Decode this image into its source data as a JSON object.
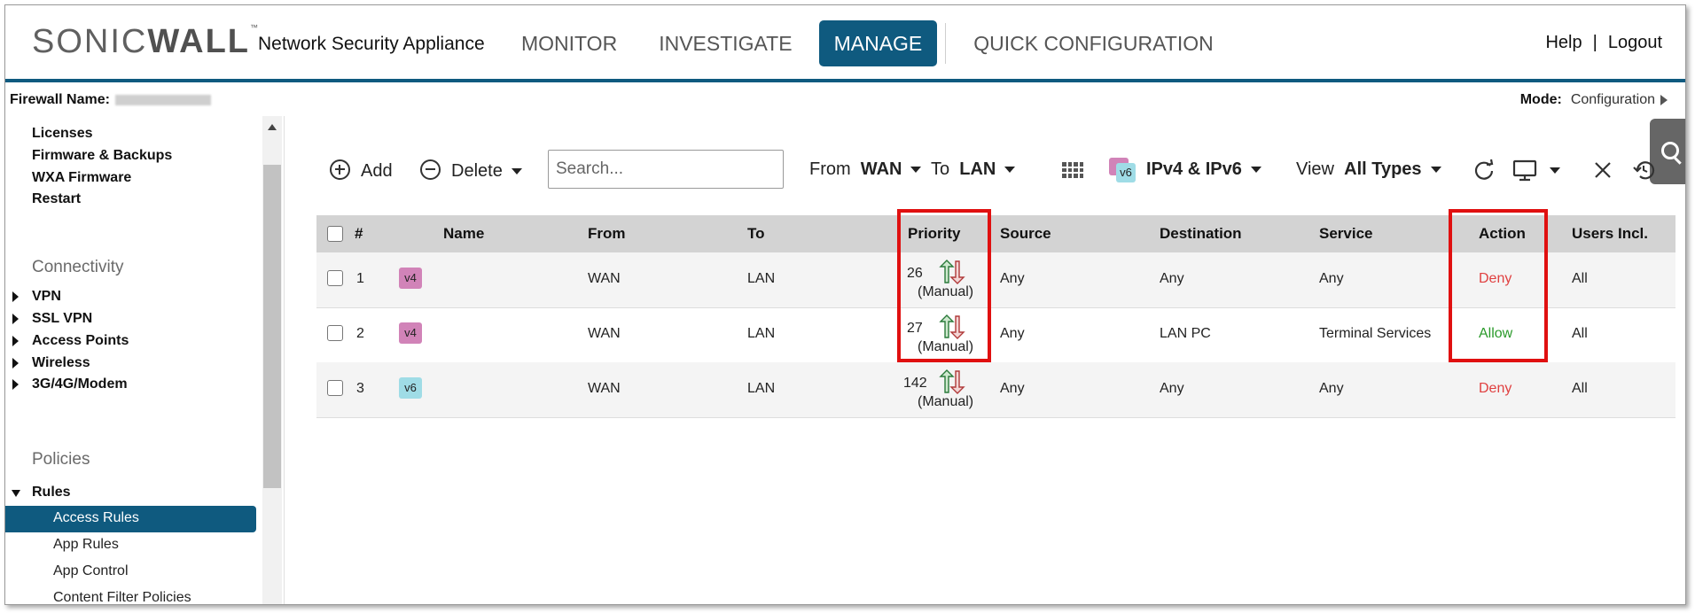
{
  "header": {
    "logo_sonic": "SONIC",
    "logo_wall": "WALL",
    "logo_tm": "™",
    "app_name": "Network Security Appliance",
    "nav": [
      "MONITOR",
      "INVESTIGATE",
      "MANAGE",
      "QUICK CONFIGURATION"
    ],
    "nav_active": "MANAGE",
    "help": "Help",
    "separator": "|",
    "logout": "Logout"
  },
  "info": {
    "firewall_label": "Firewall Name:",
    "mode_label": "Mode:",
    "mode_value": "Configuration"
  },
  "sidebar": {
    "top_items": [
      "Licenses",
      "Firmware & Backups",
      "WXA Firmware",
      "Restart"
    ],
    "connectivity_label": "Connectivity",
    "connectivity_items": [
      "VPN",
      "SSL VPN",
      "Access Points",
      "Wireless",
      "3G/4G/Modem"
    ],
    "policies_label": "Policies",
    "rules_label": "Rules",
    "rules_items": [
      "Access Rules",
      "App Rules",
      "App Control",
      "Content Filter Policies"
    ],
    "active_item": "Access Rules"
  },
  "toolbar": {
    "add": "Add",
    "delete": "Delete",
    "search_placeholder": "Search...",
    "from_label": "From",
    "from_value": "WAN",
    "to_label": "To",
    "to_value": "LAN",
    "ip_badge": "v6",
    "ip_value": "IPv4 & IPv6",
    "view_label": "View",
    "view_value": "All Types"
  },
  "table": {
    "columns": [
      "#",
      "Name",
      "From",
      "To",
      "Priority",
      "Source",
      "Destination",
      "Service",
      "Action",
      "Users Incl."
    ],
    "rows": [
      {
        "num": "1",
        "ip": "v4",
        "name": "",
        "from": "WAN",
        "to": "LAN",
        "priority": "26",
        "priority_mode": "(Manual)",
        "source": "Any",
        "destination": "Any",
        "service": "Any",
        "action": "Deny",
        "users": "All"
      },
      {
        "num": "2",
        "ip": "v4",
        "name": "",
        "from": "WAN",
        "to": "LAN",
        "priority": "27",
        "priority_mode": "(Manual)",
        "source": "Any",
        "destination": "LAN PC",
        "service": "Terminal Services",
        "action": "Allow",
        "users": "All"
      },
      {
        "num": "3",
        "ip": "v6",
        "name": "",
        "from": "WAN",
        "to": "LAN",
        "priority": "142",
        "priority_mode": "(Manual)",
        "source": "Any",
        "destination": "Any",
        "service": "Any",
        "action": "Deny",
        "users": "All"
      }
    ]
  },
  "colors": {
    "brand_blue": "#0f5a7f",
    "deny": "#e04040",
    "allow": "#2a9a2a",
    "highlight": "#e01010",
    "v4_badge": "#d183b8",
    "v6_badge": "#9fdce6"
  }
}
